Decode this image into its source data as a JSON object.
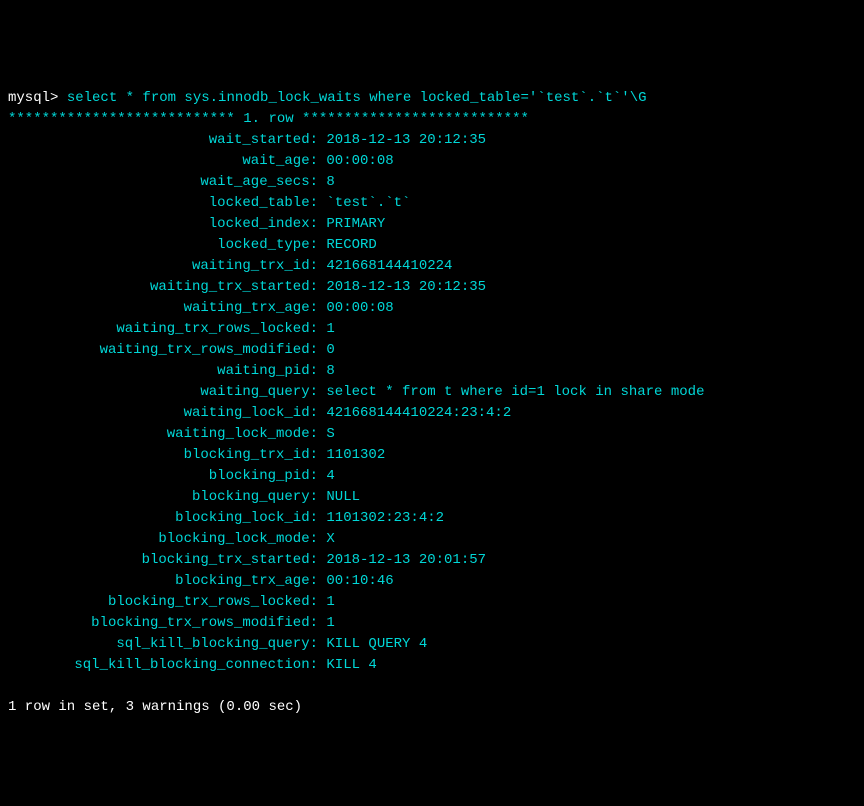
{
  "prompt": "mysql> ",
  "command": "select * from sys.innodb_lock_waits where locked_table='`test`.`t`'\\G",
  "row_header": "*************************** 1. row ***************************",
  "fields": [
    {
      "label": "wait_started",
      "value": "2018-12-13 20:12:35"
    },
    {
      "label": "wait_age",
      "value": "00:00:08"
    },
    {
      "label": "wait_age_secs",
      "value": "8"
    },
    {
      "label": "locked_table",
      "value": "`test`.`t`"
    },
    {
      "label": "locked_index",
      "value": "PRIMARY"
    },
    {
      "label": "locked_type",
      "value": "RECORD"
    },
    {
      "label": "waiting_trx_id",
      "value": "421668144410224"
    },
    {
      "label": "waiting_trx_started",
      "value": "2018-12-13 20:12:35"
    },
    {
      "label": "waiting_trx_age",
      "value": "00:00:08"
    },
    {
      "label": "waiting_trx_rows_locked",
      "value": "1"
    },
    {
      "label": "waiting_trx_rows_modified",
      "value": "0"
    },
    {
      "label": "waiting_pid",
      "value": "8"
    },
    {
      "label": "waiting_query",
      "value": "select * from t where id=1 lock in share mode"
    },
    {
      "label": "waiting_lock_id",
      "value": "421668144410224:23:4:2"
    },
    {
      "label": "waiting_lock_mode",
      "value": "S"
    },
    {
      "label": "blocking_trx_id",
      "value": "1101302"
    },
    {
      "label": "blocking_pid",
      "value": "4"
    },
    {
      "label": "blocking_query",
      "value": "NULL"
    },
    {
      "label": "blocking_lock_id",
      "value": "1101302:23:4:2"
    },
    {
      "label": "blocking_lock_mode",
      "value": "X"
    },
    {
      "label": "blocking_trx_started",
      "value": "2018-12-13 20:01:57"
    },
    {
      "label": "blocking_trx_age",
      "value": "00:10:46"
    },
    {
      "label": "blocking_trx_rows_locked",
      "value": "1"
    },
    {
      "label": "blocking_trx_rows_modified",
      "value": "1"
    },
    {
      "label": "sql_kill_blocking_query",
      "value": "KILL QUERY 4"
    },
    {
      "label": "sql_kill_blocking_connection",
      "value": "KILL 4"
    }
  ],
  "footer": "1 row in set, 3 warnings (0.00 sec)"
}
